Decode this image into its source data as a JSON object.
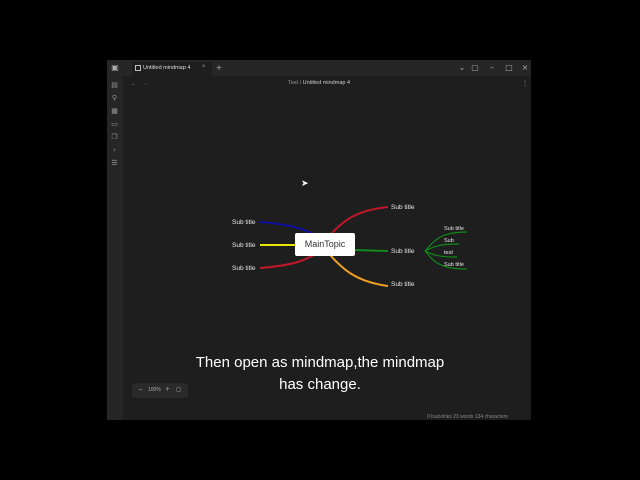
{
  "window": {
    "tab_title": "Untitled mindmap 4",
    "tab_close": "×",
    "new_tab": "+",
    "breadcrumb_folder": "Test",
    "breadcrumb_sep": "/",
    "breadcrumb_file": "Untitled mindmap 4",
    "controls": {
      "chevron": "⌄",
      "layout": "▢",
      "minimize": "–",
      "maximize": "□",
      "close": "×"
    },
    "nav_back": "←",
    "nav_forward": "→",
    "more": "⋮"
  },
  "rail_icons": [
    "file-icon",
    "graph-icon",
    "grid-icon",
    "calendar-icon",
    "copy-icon",
    "terminal-icon",
    "tasks-icon"
  ],
  "mindmap": {
    "main_topic": "MainTopic",
    "left_nodes": [
      {
        "label": "Sub title",
        "color": "#1010a0"
      },
      {
        "label": "Sub title",
        "color": "#e6e600"
      },
      {
        "label": "Sub title",
        "color": "#c0182a"
      }
    ],
    "right_nodes": [
      {
        "label": "Sub title",
        "color": "#c0182a"
      },
      {
        "label": "Sub title",
        "color": "#12891c"
      },
      {
        "label": "Sub title",
        "color": "#f0a020"
      }
    ],
    "green_children": [
      "Sub title",
      "Sub",
      "test",
      "Sub title"
    ]
  },
  "zoom": {
    "minus": "−",
    "level": "100%",
    "plus": "+",
    "fit": "◻"
  },
  "status": {
    "backlinks": "0 backlinks",
    "words": "23 words",
    "characters": "134 characters"
  },
  "caption": {
    "line1": "Then open as mindmap,the mindmap",
    "line2": "has change."
  }
}
